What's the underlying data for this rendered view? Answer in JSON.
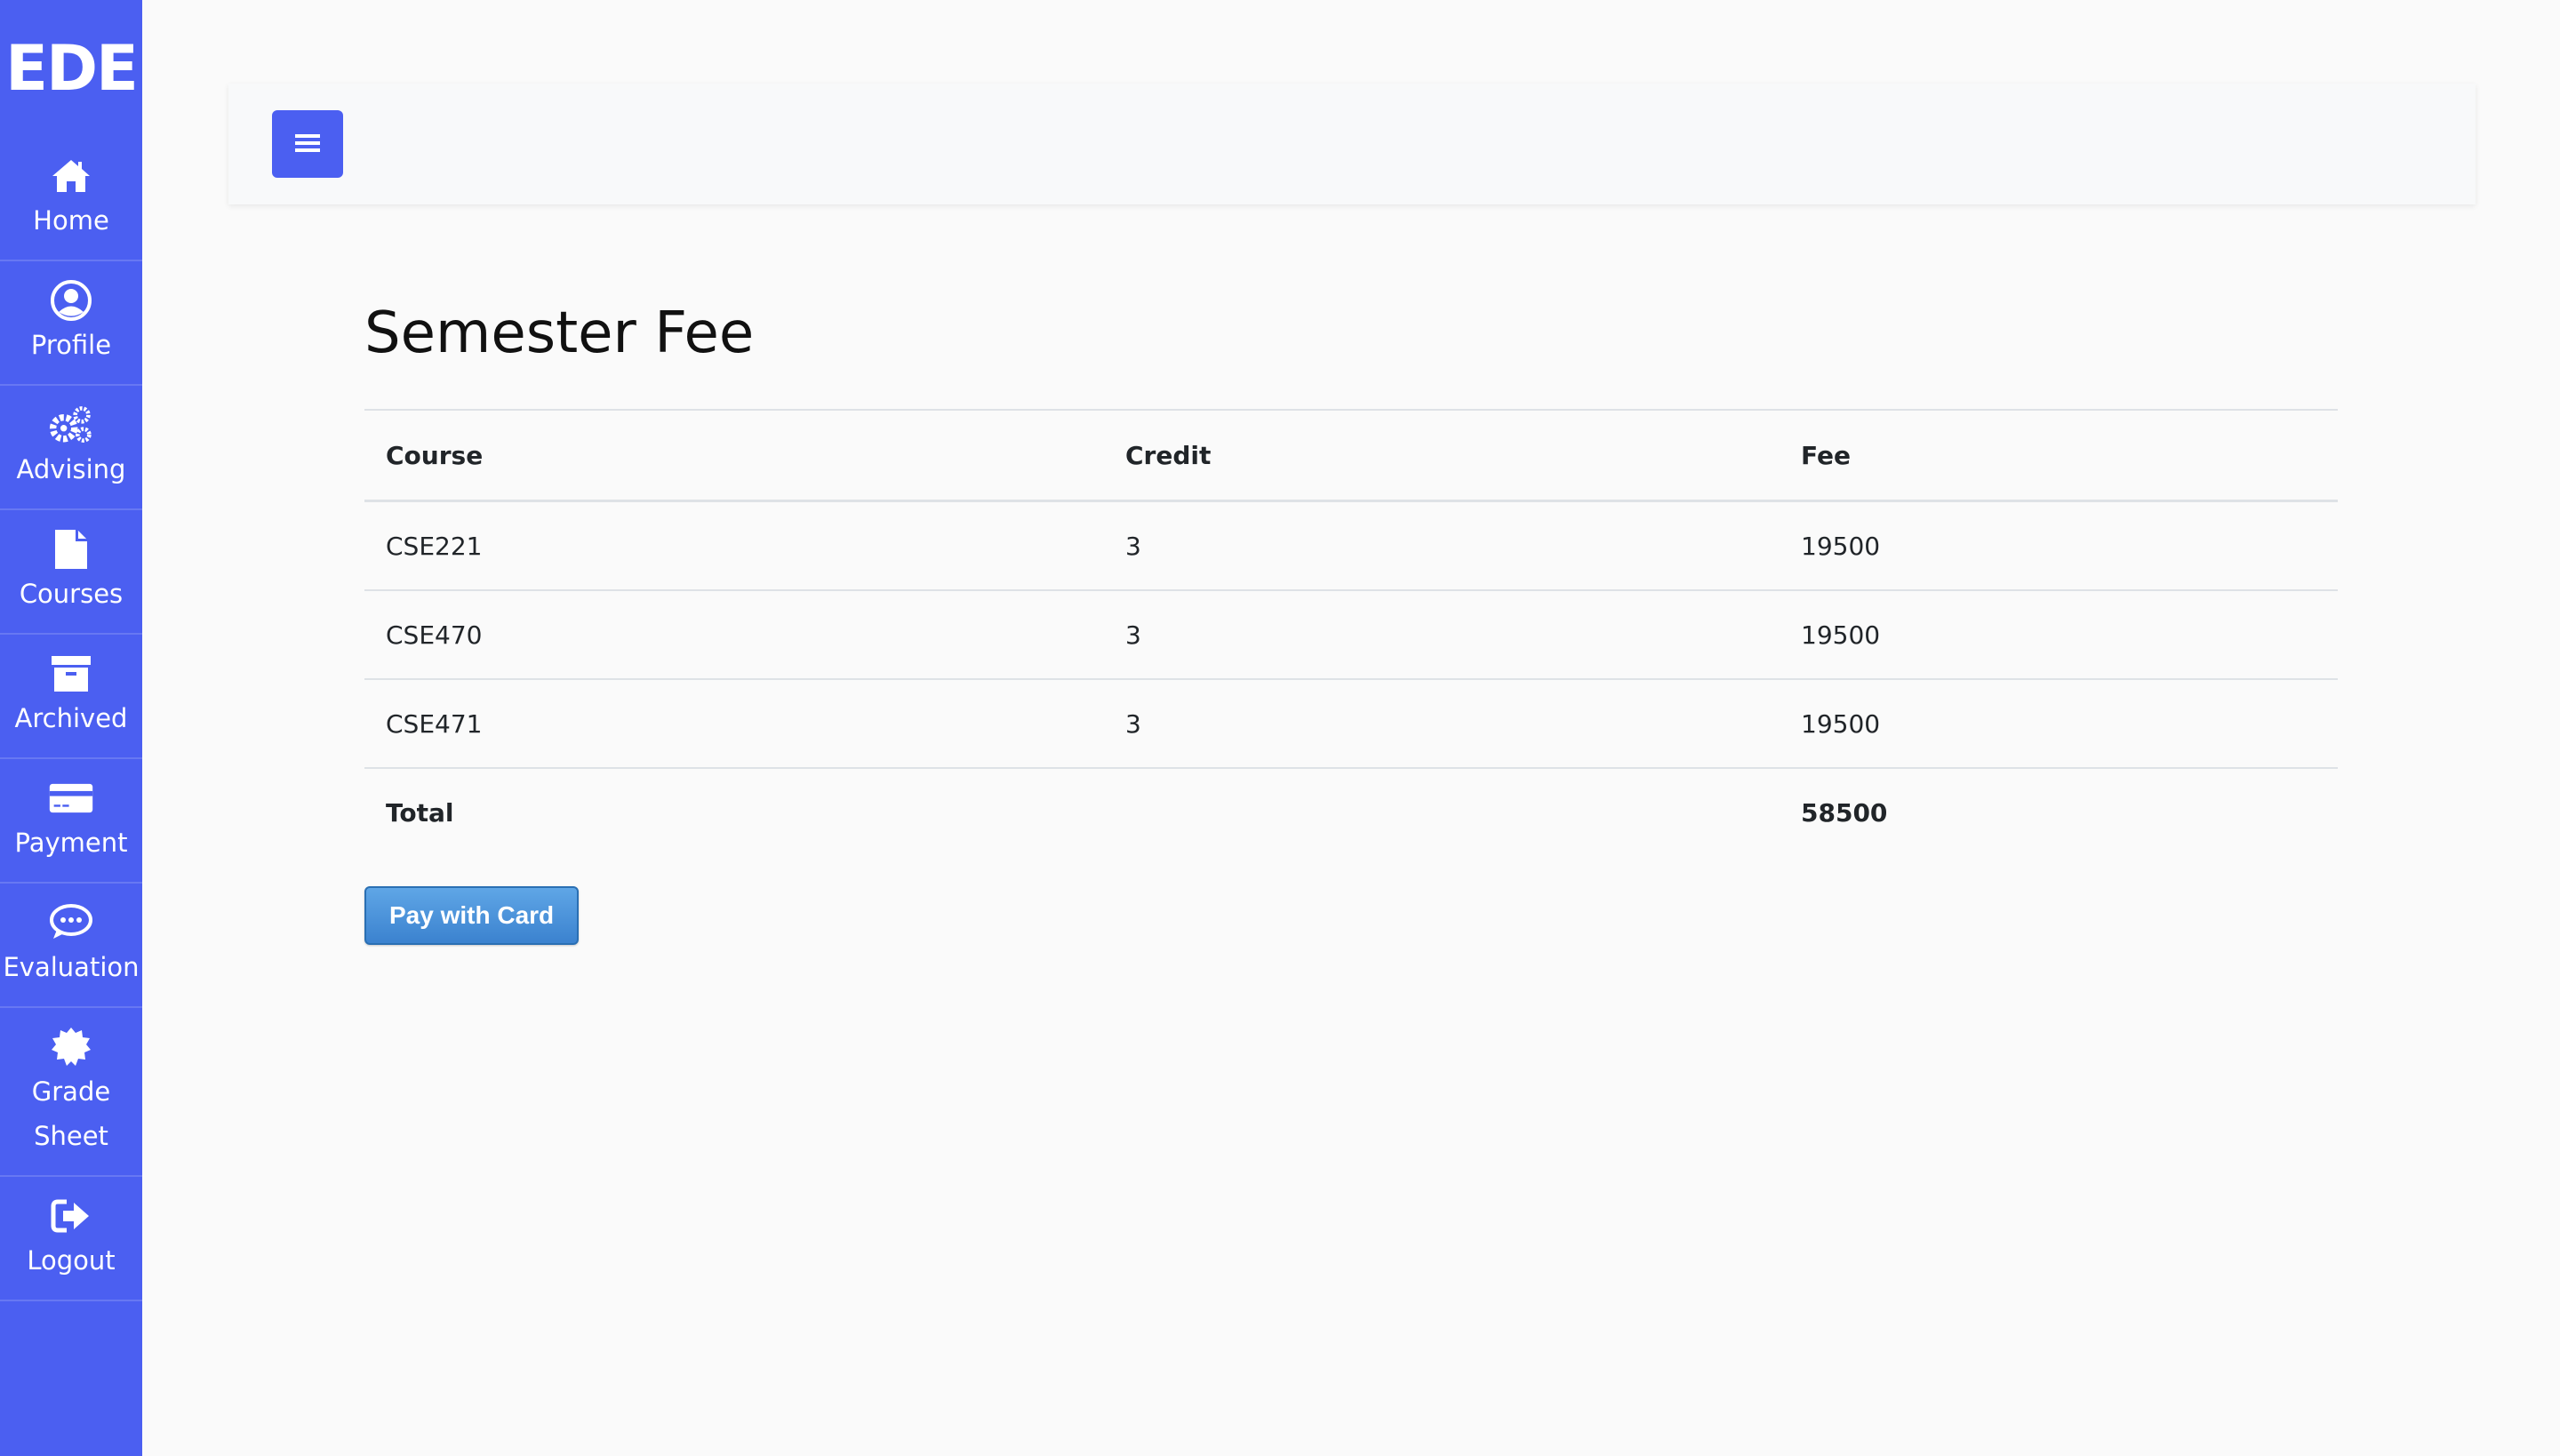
{
  "sidebar": {
    "logo": "EDE",
    "items": [
      {
        "label": "Home",
        "icon": "home-icon"
      },
      {
        "label": "Profile",
        "icon": "user-circle-icon"
      },
      {
        "label": "Advising",
        "icon": "gears-icon"
      },
      {
        "label": "Courses",
        "icon": "file-icon"
      },
      {
        "label": "Archived",
        "icon": "archive-icon"
      },
      {
        "label": "Payment",
        "icon": "credit-card-icon"
      },
      {
        "label": "Evaluation",
        "icon": "comment-dots-icon"
      },
      {
        "label": "Grade Sheet",
        "icon": "certificate-icon"
      },
      {
        "label": "Logout",
        "icon": "sign-out-icon"
      }
    ]
  },
  "topbar": {
    "menu_icon": "hamburger-icon"
  },
  "main": {
    "title": "Semester Fee",
    "table": {
      "headers": [
        "Course",
        "Credit",
        "Fee"
      ],
      "rows": [
        [
          "CSE221",
          "3",
          "19500"
        ],
        [
          "CSE470",
          "3",
          "19500"
        ],
        [
          "CSE471",
          "3",
          "19500"
        ]
      ],
      "total_label": "Total",
      "total_value": "58500"
    },
    "pay_button": "Pay with Card"
  },
  "colors": {
    "sidebar": "#4b5ff1",
    "background": "#fafafa",
    "pay_button": "#3b82cf"
  }
}
